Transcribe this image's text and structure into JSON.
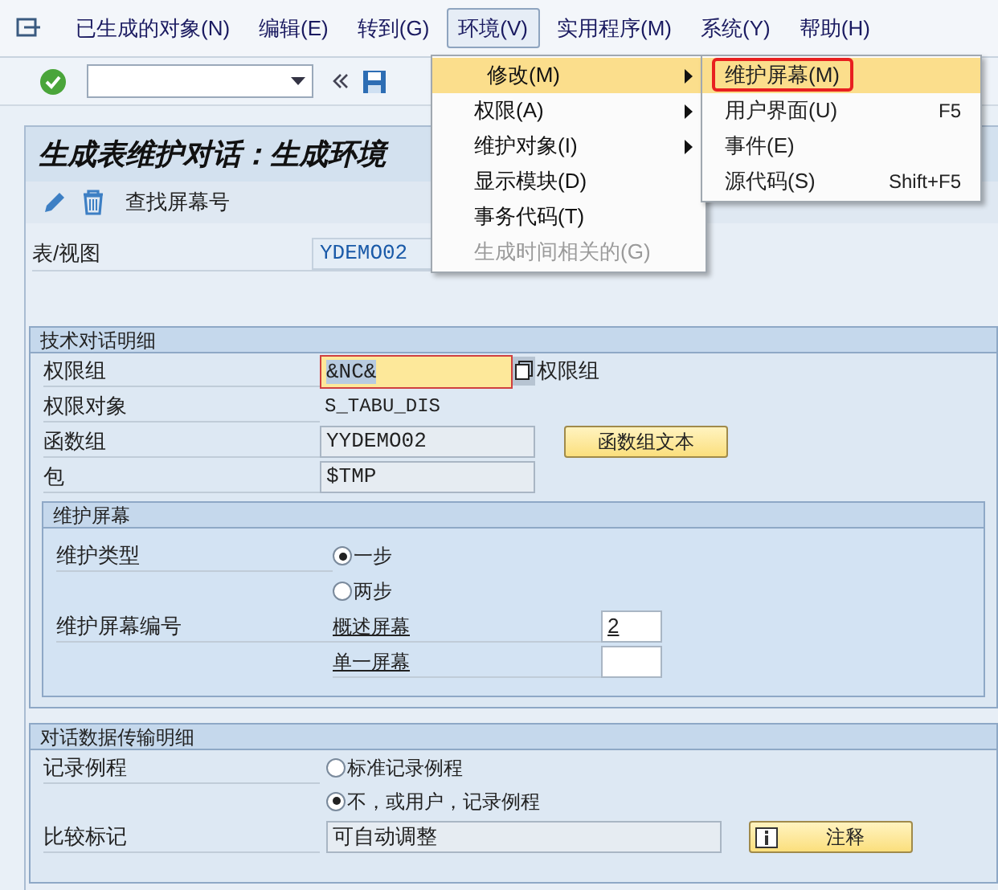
{
  "menu_bar": {
    "items": [
      {
        "label": "已生成的对象(N)",
        "selected": false
      },
      {
        "label": "编辑(E)",
        "selected": false
      },
      {
        "label": "转到(G)",
        "selected": false
      },
      {
        "label": "环境(V)",
        "selected": true
      },
      {
        "label": "实用程序(M)",
        "selected": false
      },
      {
        "label": "系统(Y)",
        "selected": false
      },
      {
        "label": "帮助(H)",
        "selected": false
      }
    ]
  },
  "title": "生成表维护对话：生成环境",
  "app_toolbar": {
    "find_button": "查找屏幕号"
  },
  "table_view": {
    "label": "表/视图",
    "value": "YDEMO02"
  },
  "tech_group": {
    "title": "技术对话明细",
    "rows": [
      {
        "kind": "input",
        "label": "权限组",
        "value": "&NC&",
        "focused": true,
        "suffix": "权限组"
      },
      {
        "kind": "text",
        "label": "权限对象",
        "value": "S_TABU_DIS"
      },
      {
        "kind": "readonly",
        "label": "函数组",
        "value": "YYDEMO02",
        "button": "函数组文本"
      },
      {
        "kind": "readonly",
        "label": "包",
        "value": "$TMP"
      }
    ]
  },
  "screen_group": {
    "title": "维护屏幕",
    "type_label": "维护类型",
    "options": [
      {
        "label": "一步",
        "selected": true
      },
      {
        "label": "两步",
        "selected": false
      }
    ],
    "number_label": "维护屏幕编号",
    "numbers": [
      {
        "label": "概述屏幕",
        "value": "2"
      },
      {
        "label": "单一屏幕"
      }
    ]
  },
  "transfer_group": {
    "title": "对话数据传输明细",
    "routine_label": "记录例程",
    "options": [
      {
        "label": "标准记录例程",
        "selected": false
      },
      {
        "label": "不，或用户，记录例程",
        "selected": true
      }
    ],
    "compare_label": "比较标记",
    "compare_value": "可自动调整",
    "note_button": "注释"
  },
  "env_menu": {
    "items": [
      {
        "label": "修改(M)",
        "selected": true,
        "submenu": true,
        "disabled": false
      },
      {
        "label": "权限(A)",
        "selected": false,
        "submenu": true,
        "disabled": false
      },
      {
        "label": "维护对象(I)",
        "selected": false,
        "submenu": true,
        "disabled": false
      },
      {
        "label": "显示模块(D)",
        "selected": false,
        "submenu": false,
        "disabled": false
      },
      {
        "label": "事务代码(T)",
        "selected": false,
        "submenu": false,
        "disabled": false
      },
      {
        "label": "生成时间相关的(G)",
        "selected": false,
        "submenu": false,
        "disabled": true
      }
    ]
  },
  "sub_menu": {
    "items": [
      {
        "label": "维护屏幕(M)",
        "selected": true,
        "marked": true
      },
      {
        "label": "用户界面(U)",
        "shortcut": "F5",
        "selected": false,
        "marked": false
      },
      {
        "label": "事件(E)",
        "selected": false,
        "marked": false
      },
      {
        "label": "源代码(S)",
        "shortcut": "Shift+F5",
        "selected": false,
        "marked": false
      }
    ]
  }
}
